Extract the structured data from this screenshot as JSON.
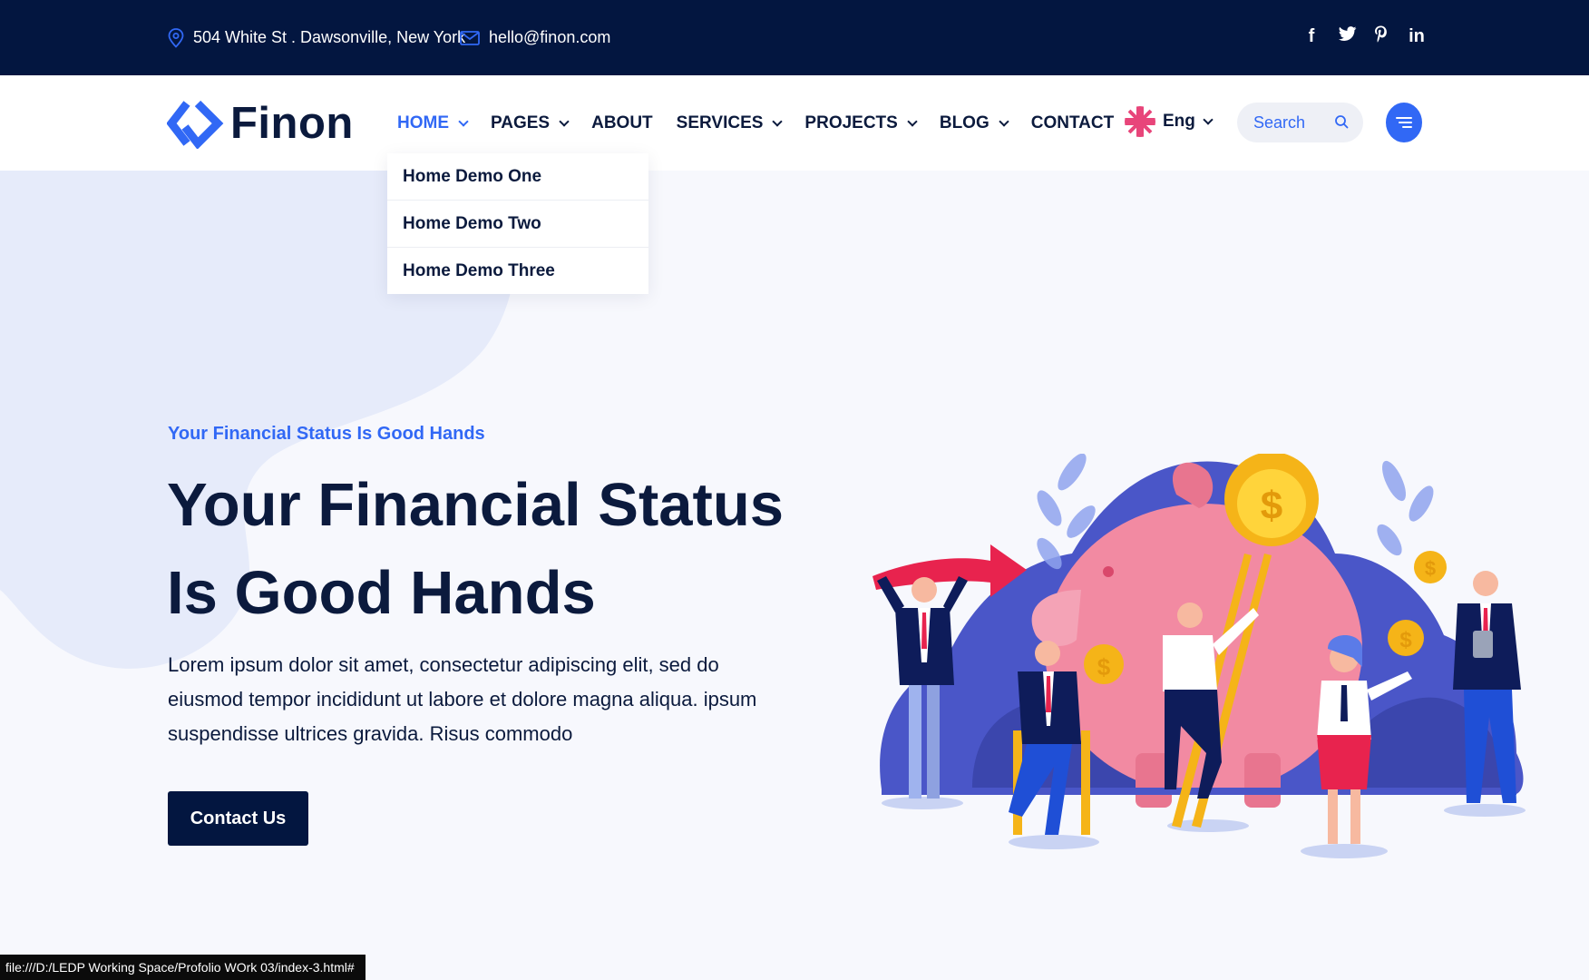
{
  "topbar": {
    "address": "504 White St . Dawsonville, New York",
    "email": "hello@finon.com",
    "social": [
      "facebook-icon",
      "twitter-icon",
      "pinterest-icon",
      "linkedin-icon"
    ]
  },
  "header": {
    "logo_text": "Finon",
    "nav": [
      {
        "label": "HOME",
        "dropdown": true,
        "active": true
      },
      {
        "label": "PAGES",
        "dropdown": true
      },
      {
        "label": "ABOUT",
        "dropdown": false
      },
      {
        "label": "SERVICES",
        "dropdown": true
      },
      {
        "label": "PROJECTS",
        "dropdown": true
      },
      {
        "label": "BLOG",
        "dropdown": true
      },
      {
        "label": "CONTACT",
        "dropdown": false
      }
    ],
    "language": "Eng",
    "search_placeholder": "Search"
  },
  "dropdown": {
    "items": [
      "Home Demo One",
      "Home Demo Two",
      "Home Demo Three"
    ]
  },
  "hero": {
    "eyebrow": "Your Financial Status Is Good Hands",
    "title_line1": "Your Financial Status",
    "title_line2": "Is Good Hands",
    "text": "Lorem ipsum dolor sit amet, consectetur adipiscing elit, sed do eiusmod tempor incididunt ut labore et dolore magna aliqua. ipsum suspendisse ultrices gravida. Risus commodo",
    "cta_label": "Contact Us"
  },
  "statusbar": {
    "url": "file:///D:/LEDP Working Space/Profolio WOrk 03/index-3.html#"
  },
  "colors": {
    "navy": "#031640",
    "accent": "#3168f5",
    "background": "#f7f8fd"
  }
}
